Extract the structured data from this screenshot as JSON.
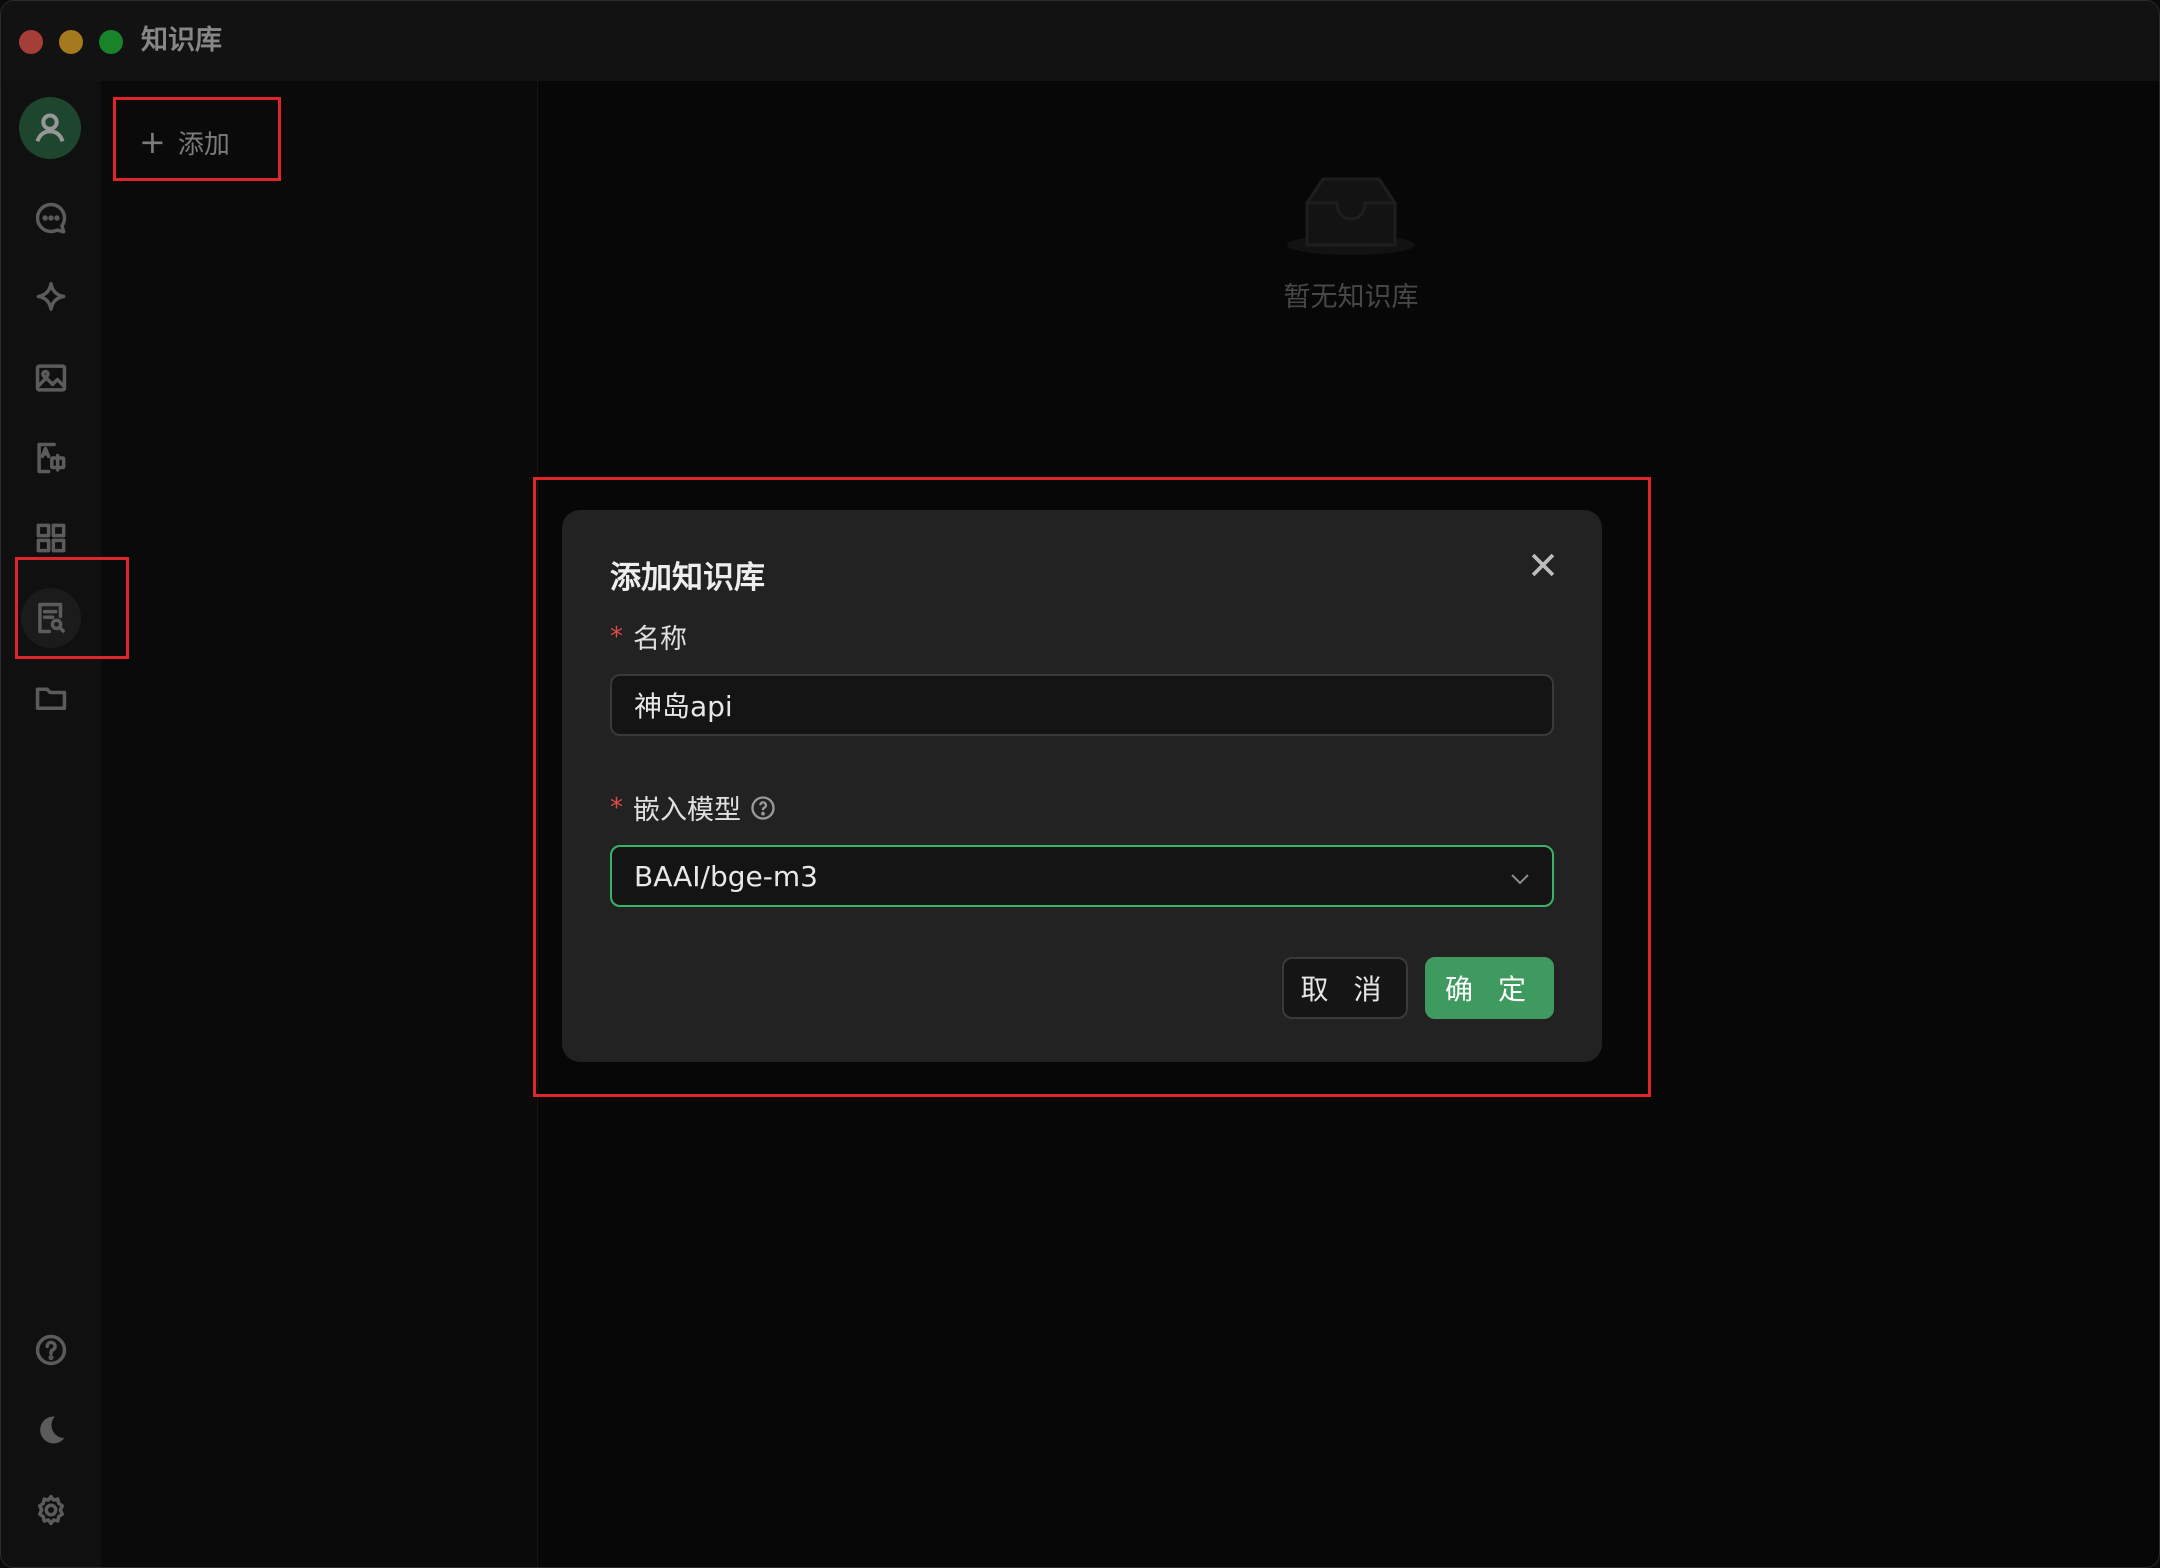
{
  "window": {
    "title": "知识库"
  },
  "sidebar": {
    "items": [
      {
        "name": "chat",
        "icon": "chat-bubble-icon"
      },
      {
        "name": "assistant",
        "icon": "sparkle-icon"
      },
      {
        "name": "image",
        "icon": "image-icon"
      },
      {
        "name": "translate",
        "icon": "translate-icon"
      },
      {
        "name": "apps",
        "icon": "grid-icon"
      },
      {
        "name": "knowledge",
        "icon": "knowledge-search-icon",
        "active": true
      },
      {
        "name": "files",
        "icon": "folder-icon"
      }
    ],
    "bottom": [
      {
        "name": "help",
        "icon": "help-circle-icon"
      },
      {
        "name": "theme",
        "icon": "moon-icon"
      },
      {
        "name": "settings",
        "icon": "gear-icon"
      }
    ]
  },
  "list": {
    "add_label": "添加"
  },
  "main": {
    "empty_text": "暂无知识库"
  },
  "modal": {
    "title": "添加知识库",
    "name_label": "名称",
    "name_value": "神岛api",
    "model_label": "嵌入模型",
    "model_value": "BAAI/bge-m3",
    "cancel_label": "取 消",
    "ok_label": "确 定"
  },
  "colors": {
    "accent": "#3e9a5e",
    "annotation": "#e0252a",
    "required": "#e04a4a"
  }
}
